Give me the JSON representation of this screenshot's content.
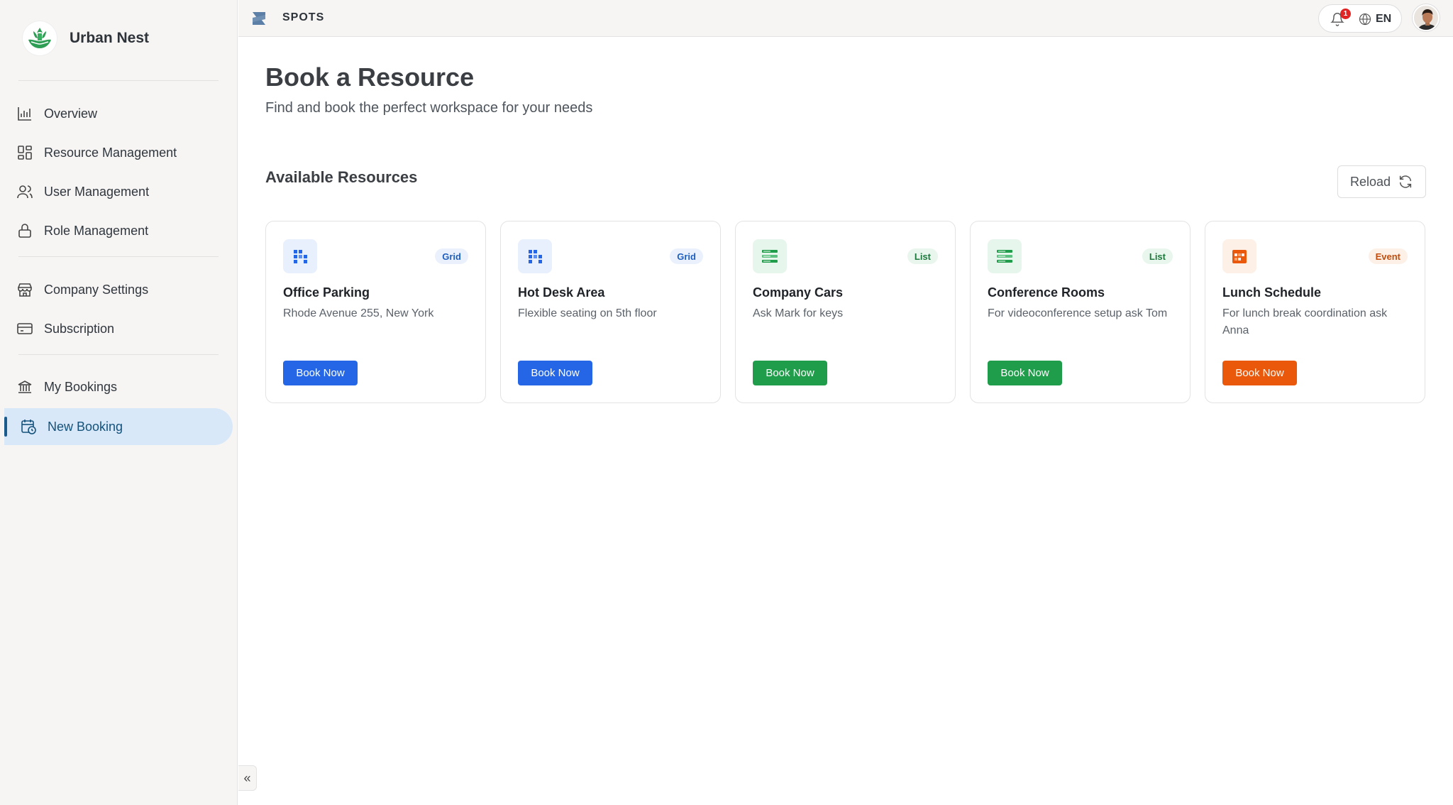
{
  "sidebar": {
    "brand_name": "Urban Nest",
    "items": [
      {
        "label": "Overview",
        "icon": "bar-chart-icon"
      },
      {
        "label": "Resource Management",
        "icon": "grid-icon"
      },
      {
        "label": "User Management",
        "icon": "users-icon"
      },
      {
        "label": "Role Management",
        "icon": "lock-icon"
      },
      {
        "label": "Company Settings",
        "icon": "store-icon"
      },
      {
        "label": "Subscription",
        "icon": "credit-card-icon"
      },
      {
        "label": "My Bookings",
        "icon": "bank-icon"
      },
      {
        "label": "New Booking",
        "icon": "calendar-clock-icon",
        "active": true
      }
    ],
    "collapse_label": "«"
  },
  "topbar": {
    "app_name": "SPOTS",
    "notification_count": "1",
    "language": "EN"
  },
  "main": {
    "title": "Book a Resource",
    "subtitle": "Find and book the perfect workspace for your needs",
    "section_title": "Available Resources",
    "reload_label": "Reload"
  },
  "resources": [
    {
      "title": "Office Parking",
      "description": "Rhode Avenue 255, New York",
      "badge": "Grid",
      "button": "Book Now",
      "theme": "blue",
      "color": "#2566e6"
    },
    {
      "title": "Hot Desk Area",
      "description": "Flexible seating on 5th floor",
      "badge": "Grid",
      "button": "Book Now",
      "theme": "blue",
      "color": "#2566e6"
    },
    {
      "title": "Company Cars",
      "description": "Ask Mark for keys",
      "badge": "List",
      "button": "Book Now",
      "theme": "green",
      "color": "#1f9d4a"
    },
    {
      "title": "Conference Rooms",
      "description": "For videoconference setup ask Tom",
      "badge": "List",
      "button": "Book Now",
      "theme": "green",
      "color": "#1f9d4a"
    },
    {
      "title": "Lunch Schedule",
      "description": "For lunch break coordination ask Anna",
      "badge": "Event",
      "button": "Book Now",
      "theme": "orange",
      "color": "#ea580c"
    }
  ]
}
